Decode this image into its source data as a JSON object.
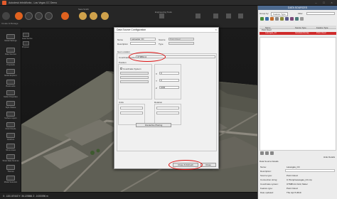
{
  "window": {
    "title": "Autodesk InfraWorks - Las Vegas CC Demo"
  },
  "toolbar": {
    "user_label": "Sara Smith",
    "engineering_label": "Engineering Tools",
    "sub_label": "Create & Manage"
  },
  "left_tools": [
    "Model Settings",
    "Data Sources",
    "Proposals",
    "Model Explorer",
    "Bookmarks",
    "Model Properties",
    "Style Palette",
    "Surface Layers",
    "Point Clouds",
    "Grid/Axis",
    "Show Areas",
    "Show Data Sources",
    "Themes",
    "Model Selection",
    "Shape Editor",
    "Model Updates"
  ],
  "widgets": [
    "Model Settings",
    "Asset Service",
    "Proposal",
    "Point Cloud"
  ],
  "statusbar": {
    "coords": "X: -115.167443 Y: 36.125866 Z: -0.000096 m"
  },
  "dialog": {
    "title": "Data Source Configuration",
    "name_label": "Name",
    "name_value": "Lasvegas_CC",
    "source_label": "Source",
    "source_value": "Point Cloud",
    "description_label": "Description",
    "type_label": "Type",
    "tabs": "Geo Location",
    "coord_system_label": "Coordinate System",
    "coord_system_value": "UTM83-11",
    "position_label": "Position",
    "coord_sys_sub": "Coordinate System",
    "units_label": "Units",
    "rotation_label": "Rotation",
    "interactive_button": "Interactive Placing",
    "close_refresh_button": "Close & Refresh",
    "close_button": "Close",
    "field_x": "X",
    "field_y": "Y",
    "field_z": "Z",
    "value_zero": "0",
    "value_1000": "1000"
  },
  "data_sources_panel": {
    "title": "DATA SOURCES",
    "group_by_label": "Group by:",
    "group_by_value": "Feature Type",
    "filter_label": "Filter",
    "columns": [
      "Name",
      "Source Type",
      "Feature Type"
    ],
    "rows": [
      {
        "name": "Point Cloud",
        "source": "",
        "feature": ""
      },
      {
        "name": "Lasvegas_CC",
        "source": "Autodesk ReCap",
        "feature": "Point Cloud"
      }
    ],
    "hide_details": "Hide Details",
    "details_title": "Data Source Details",
    "properties": [
      {
        "label": "Name:",
        "value": "Lasvegas_CC"
      },
      {
        "label": "Description:",
        "value": ""
      },
      {
        "label": "Source type:",
        "value": "Point Cloud"
      },
      {
        "label": "Connection string:",
        "value": "C:/Temp/Lasvegas_CC.rcp"
      },
      {
        "label": "Coordinate system:",
        "value": "UTM83-11 Grid, Meter"
      },
      {
        "label": "Feature type:",
        "value": "Point Cloud"
      },
      {
        "label": "Date updated:",
        "value": "Thu Apr 8 2019"
      }
    ]
  }
}
